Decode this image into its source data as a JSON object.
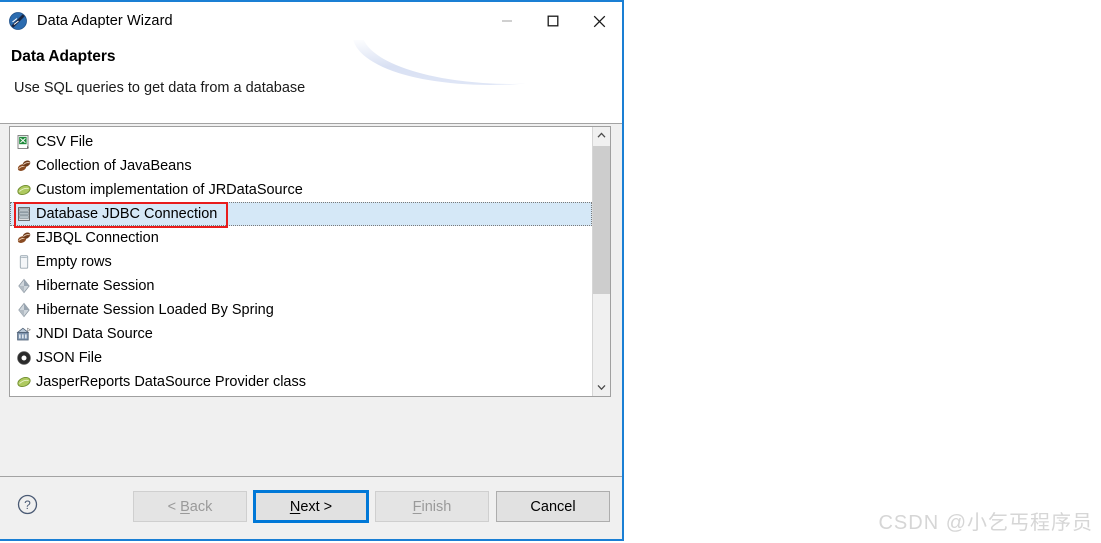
{
  "window": {
    "title": "Data Adapter Wizard",
    "app_icon": "jaspersoft-logo-icon",
    "controls": {
      "minimize": "minimize-icon",
      "maximize": "maximize-icon",
      "close": "close-icon"
    }
  },
  "header": {
    "title": "Data Adapters",
    "subtitle": "Use SQL queries to get data from a database"
  },
  "list": {
    "items": [
      {
        "label": "CSV File",
        "icon": "csv-file-icon",
        "selected": false
      },
      {
        "label": "Collection of JavaBeans",
        "icon": "coffee-beans-icon",
        "selected": false
      },
      {
        "label": "Custom implementation of JRDataSource",
        "icon": "green-bean-icon",
        "selected": false
      },
      {
        "label": "Database JDBC Connection",
        "icon": "database-icon",
        "selected": true
      },
      {
        "label": "EJBQL Connection",
        "icon": "coffee-beans-icon",
        "selected": false
      },
      {
        "label": "Empty rows",
        "icon": "empty-rows-icon",
        "selected": false
      },
      {
        "label": "Hibernate Session",
        "icon": "hibernate-icon",
        "selected": false
      },
      {
        "label": "Hibernate Session Loaded By Spring",
        "icon": "hibernate-icon",
        "selected": false
      },
      {
        "label": "JNDI Data Source",
        "icon": "jndi-icon",
        "selected": false
      },
      {
        "label": "JSON File",
        "icon": "json-ring-icon",
        "selected": false
      },
      {
        "label": "JasperReports DataSource Provider class",
        "icon": "green-bean-icon",
        "selected": false
      }
    ],
    "scrollbar": {
      "up_arrow": "chevron-up-icon",
      "down_arrow": "chevron-down-icon"
    }
  },
  "annotation": {
    "highlight_color": "#e81c1c",
    "target": "Database JDBC Connection"
  },
  "footer": {
    "help_icon": "help-question-icon",
    "buttons": [
      {
        "label": "< Back",
        "mnemonic": "B",
        "state": "disabled"
      },
      {
        "label": "Next >",
        "mnemonic": "N",
        "state": "focused"
      },
      {
        "label": "Finish",
        "mnemonic": "F",
        "state": "disabled"
      },
      {
        "label": "Cancel",
        "mnemonic": "",
        "state": "normal"
      }
    ]
  },
  "watermark": {
    "text": "CSDN @小乞丐程序员"
  },
  "colors": {
    "dialog_border": "#1a7fd4",
    "selection": "#d5e8f7",
    "focus_blue": "#0078d7",
    "annotation_red": "#e81c1c"
  }
}
